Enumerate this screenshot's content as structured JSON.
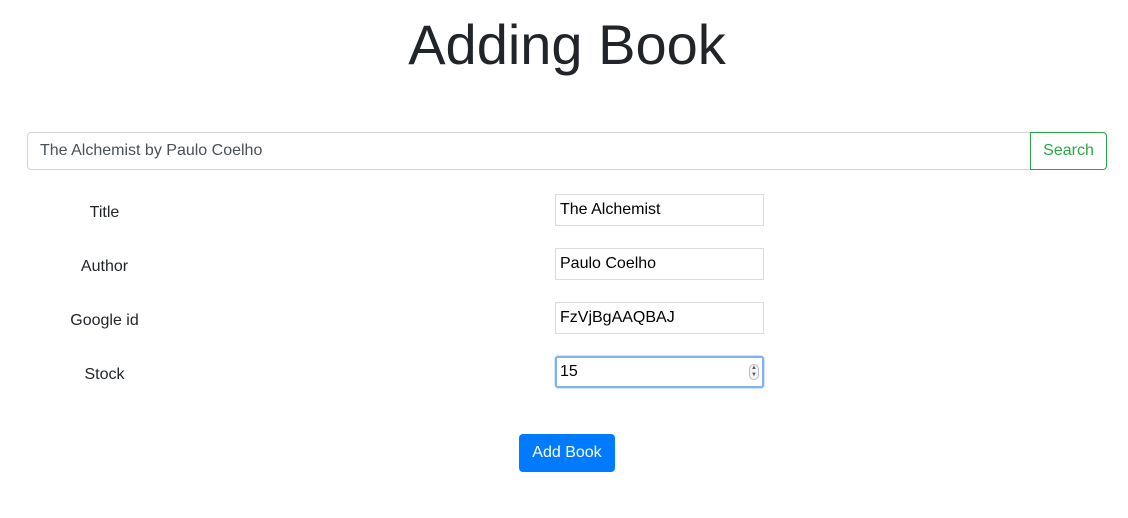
{
  "page": {
    "title": "Adding Book"
  },
  "search": {
    "value": "The Alchemist by Paulo Coelho",
    "button_label": "Search"
  },
  "form": {
    "fields": [
      {
        "label": "Title",
        "value": "The Alchemist"
      },
      {
        "label": "Author",
        "value": "Paulo Coelho"
      },
      {
        "label": "Google id",
        "value": "FzVjBgAAQBAJ"
      },
      {
        "label": "Stock",
        "value": "15"
      }
    ],
    "submit_label": "Add Book"
  },
  "colors": {
    "primary": "#007bff",
    "success": "#28a745",
    "focus_ring": "#7fb2f0"
  },
  "icons": {
    "stock_stepper": "number-stepper-icon"
  }
}
